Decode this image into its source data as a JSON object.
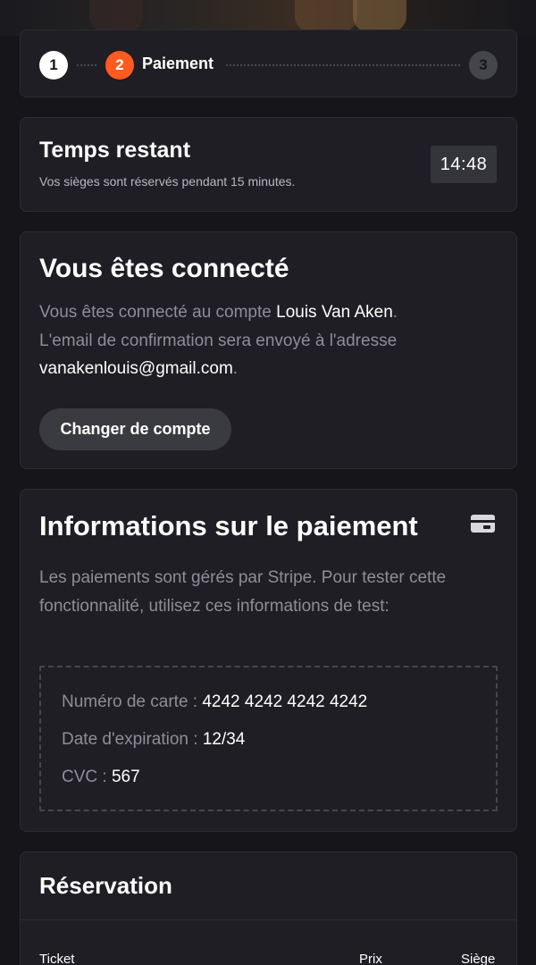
{
  "stepper": {
    "steps": [
      {
        "number": "1"
      },
      {
        "number": "2",
        "label": "Paiement"
      },
      {
        "number": "3"
      }
    ],
    "colors": {
      "active": "#ff5a1f",
      "done": "#ffffff",
      "upcoming": "#45454c"
    }
  },
  "timer": {
    "title": "Temps restant",
    "subtitle": "Vos sièges sont réservés pendant 15 minutes.",
    "value": "14:48"
  },
  "account": {
    "title": "Vous êtes connecté",
    "text_1": "Vous êtes connecté au compte ",
    "user_name": "Louis Van Aken",
    "text_2": ".",
    "text_3": "L'email de confirmation sera envoyé à l'adresse",
    "email": "vanakenlouis@gmail.com",
    "text_4": ".",
    "change_button": "Changer de compte"
  },
  "payment": {
    "title": "Informations sur le paiement",
    "icon": "credit-card-icon",
    "description": "Les paiements sont gérés par Stripe. Pour tester cette fonctionnalité, utilisez ces informations de test:",
    "test_info": {
      "card_label": "Numéro de carte : ",
      "card_value": "4242 4242 4242 4242",
      "expiry_label": "Date d'expiration : ",
      "expiry_value": "12/34",
      "cvc_label": "CVC : ",
      "cvc_value": "567"
    }
  },
  "reservation": {
    "title": "Réservation",
    "columns": [
      "Ticket",
      "Prix",
      "Siège"
    ]
  }
}
